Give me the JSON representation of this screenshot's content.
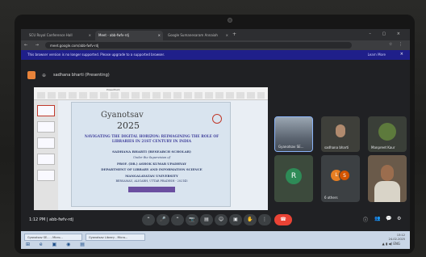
{
  "browser": {
    "tabs": [
      {
        "label": "SCU Royal Conference Hall",
        "close": "×"
      },
      {
        "label": "Meet - abb-fwfv-rdj",
        "close": "×"
      },
      {
        "label": "Google Sumanesaram Annaiah",
        "close": "×"
      }
    ],
    "new_tab": "+",
    "window_controls": "– ▢ ×",
    "nav_icons": "← → ⟳",
    "url": "meet.google.com/abb-fwfv-rdj",
    "address_icons": "☆ ⋮",
    "infobar": {
      "message": "This browser version is no longer supported. Please upgrade to a supported browser.",
      "learn_more": "Learn More",
      "close": "×"
    }
  },
  "meet": {
    "presenter_label": "sadhana bharti (Presenting)",
    "slide": {
      "app_title": "PowerPoint",
      "title_line1": "Gyanotsav",
      "year": "2025",
      "heading": "NAVIGATING THE DIGITAL HORIZON: REIMAGINING THE ROLE OF LIBRARIES IN 21ST CENTURY IN INDIA",
      "scholar": "SADHANA BHARTI (RESEARCH SCHOLAR)",
      "supervision": "Under the Supervision of",
      "professor": "PROF. (DR.) ASHOK KUMAR UPADHYAY",
      "department": "DEPARTMENT OF LIBRARY AND INFORMATION SCIENCE",
      "university": "MANGALAYATAN UNIVERSITY",
      "place": "BERSAMAU, ALIGARH, UTTAR PRADESH - 202145"
    },
    "participants": [
      {
        "name": "Gyanotsav SE...",
        "initial": ""
      },
      {
        "name": "sadhana bharti",
        "initial": ""
      },
      {
        "name": "Manpreet Kaur",
        "initial": ""
      },
      {
        "name": "",
        "initial": "R"
      },
      {
        "name": "6 others",
        "initial": "L"
      },
      {
        "name": "",
        "initial": ""
      }
    ],
    "others_second_initial": "S",
    "time": "1:12 PM",
    "separator": "|",
    "meeting_code": "abb-fwfv-rdj",
    "controls": [
      "⌃",
      "🎤",
      "⌃",
      "📷",
      "▤",
      "☺",
      "▣",
      "✋",
      "⋮"
    ],
    "end_call": "☎",
    "right_icons": [
      "ⓘ",
      "👥",
      "💬",
      "⚙"
    ]
  },
  "taskbar": {
    "items": [
      "Gyanotsav SE... - Micro...",
      "Gyanotsav Library - Micro..."
    ],
    "icons": "⊞ e ▣ ◉ ▤",
    "tray": "▲ ▮ ◀) ENG",
    "time": "13:12",
    "date": "24-02-2025"
  }
}
